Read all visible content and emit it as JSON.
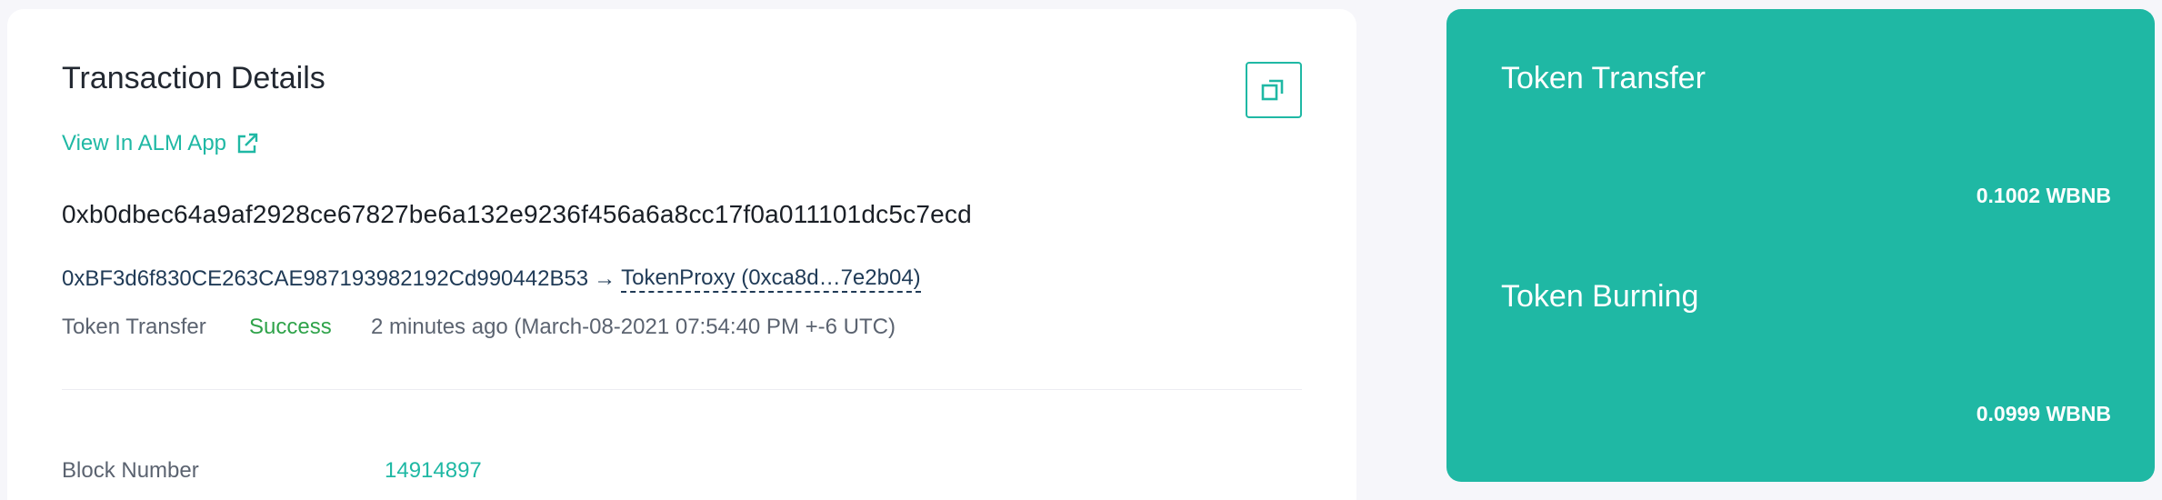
{
  "details": {
    "title": "Transaction Details",
    "alm_link_label": "View In ALM App",
    "tx_hash": "0xb0dbec64a9af2928ce67827be6a132e9236f456a6a8cc17f0a011101dc5c7ecd",
    "from_address": "0xBF3d6f830CE263CAE987193982192Cd990442B53",
    "arrow": "→",
    "to_label": "TokenProxy (0xca8d…7e2b04)",
    "tx_type": "Token Transfer",
    "status": "Success",
    "time": "2 minutes ago (March-08-2021 07:54:40 PM +-6 UTC)",
    "block_number_label": "Block Number",
    "block_number": "14914897"
  },
  "summary": {
    "items": [
      {
        "title": "Token Transfer",
        "amount": "0.1002 WBNB"
      },
      {
        "title": "Token Burning",
        "amount": "0.0999 WBNB"
      }
    ]
  },
  "colors": {
    "accent": "#1fb8a4",
    "success": "#2fa34a",
    "background": "#f6f6fa",
    "text": "#222831"
  },
  "icons": {
    "copy": "copy-icon",
    "external_link": "external-link-icon"
  }
}
